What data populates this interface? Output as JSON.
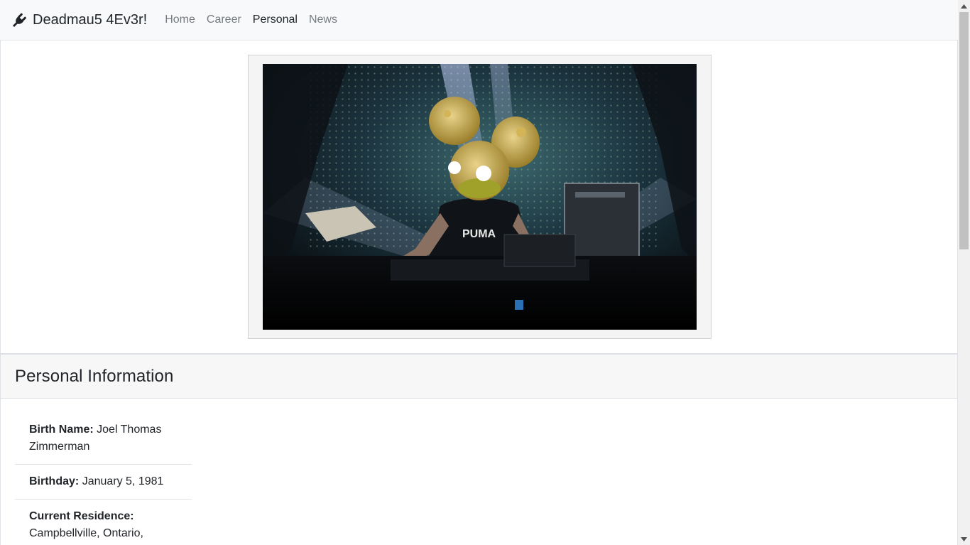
{
  "navbar": {
    "brand_icon": "plug-icon",
    "brand_text": "Deadmau5 4Ev3r!",
    "links": [
      {
        "label": "Home",
        "active": false
      },
      {
        "label": "Career",
        "active": false
      },
      {
        "label": "Personal",
        "active": true
      },
      {
        "label": "News",
        "active": false
      }
    ]
  },
  "photo": {
    "subject": "deadmau5 performing in mouse helmet",
    "shirt_text": "PUMA"
  },
  "personal_info": {
    "title": "Personal Information",
    "items": [
      {
        "label": "Birth Name:",
        "value": "Joel Thomas Zimmerman"
      },
      {
        "label": "Birthday:",
        "value": "January 5, 1981"
      },
      {
        "label": "Current Residence:",
        "value": "Campbellville, Ontario,"
      }
    ]
  },
  "colors": {
    "navbar_bg": "#f8f9fa",
    "nav_inactive": "#777b80",
    "nav_active": "#212529",
    "card_header_bg": "#f7f7f7",
    "border": "#dee2e6"
  }
}
